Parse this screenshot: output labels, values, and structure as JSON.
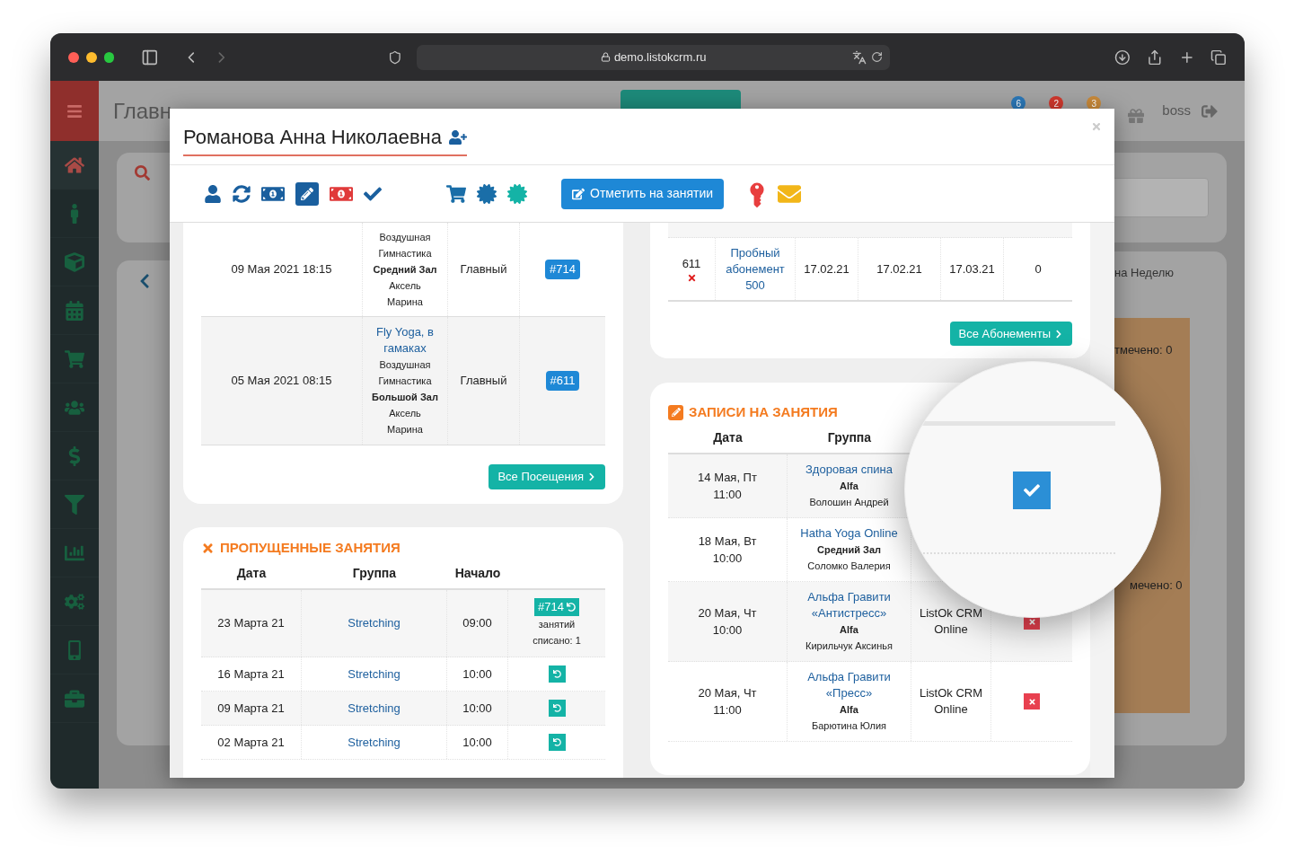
{
  "browser": {
    "url": "demo.listokcrm.ru"
  },
  "app": {
    "page_title": "Главн",
    "badges": [
      {
        "count": "6",
        "color": "#2b78b8"
      },
      {
        "count": "2",
        "color": "#d0392e"
      },
      {
        "count": "3",
        "color": "#c98a3a"
      }
    ],
    "user": "boss",
    "week_tab": "на Неделю",
    "calendar_notes": [
      "тмечено: 0",
      "мечено: 0"
    ]
  },
  "modal": {
    "title": "Романова Анна Николаевна",
    "mark_button": "Отметить на занятии",
    "visits": {
      "button": "Все Посещения",
      "rows": [
        {
          "date": "09 Мая 2021 18:15",
          "category": "Воздушная Гимнастика",
          "hall": "Средний Зал",
          "teacher": "Аксель Марина",
          "branch": "Главный",
          "badge": "#714"
        },
        {
          "date": "05 Мая 2021 08:15",
          "group": "Fly Yoga, в гамаках",
          "category": "Воздушная Гимнастика",
          "hall": "Большой Зал",
          "teacher": "Аксель Марина",
          "branch": "Главный",
          "badge": "#611"
        }
      ]
    },
    "missed": {
      "title": "ПРОПУЩЕННЫЕ ЗАНЯТИЯ",
      "columns": [
        "Дата",
        "Группа",
        "Начало"
      ],
      "rows": [
        {
          "date": "23 Марта 21",
          "group": "Stretching",
          "start": "09:00",
          "badge": "#714",
          "note": "занятий списано: 1"
        },
        {
          "date": "16 Марта 21",
          "group": "Stretching",
          "start": "10:00"
        },
        {
          "date": "09 Марта 21",
          "group": "Stretching",
          "start": "10:00"
        },
        {
          "date": "02 Марта 21",
          "group": "Stretching",
          "start": "10:00"
        }
      ]
    },
    "subscriptions": {
      "button": "Все Абонементы",
      "rows": [
        {
          "number": "611",
          "cancelled": true,
          "name": "Пробный абонемент 500",
          "cells": [
            "17.02.21",
            "17.02.21",
            "17.03.21",
            "0"
          ]
        }
      ]
    },
    "records": {
      "title": "ЗАПИСИ НА ЗАНЯТИЯ",
      "columns": [
        "Дата",
        "Группа"
      ],
      "rows": [
        {
          "date": "14 Мая, Пт",
          "time": "11:00",
          "group": "Здоровая спина",
          "hall": "Alfa",
          "teacher": "Волошин Андрей"
        },
        {
          "date": "18 Мая, Вт",
          "time": "10:00",
          "group": "Hatha Yoga Online",
          "hall": "Средний Зал",
          "teacher": "Соломко Валерия"
        },
        {
          "date": "20 Мая, Чт",
          "time": "10:00",
          "group": "Альфа Гравити «Антистресс»",
          "hall": "Alfa",
          "teacher": "Кирильчук Аксинья",
          "place": "ListOk CRM Online",
          "cancel": true
        },
        {
          "date": "20 Мая, Чт",
          "time": "11:00",
          "group": "Альфа Гравити «Пресс»",
          "hall": "Alfa",
          "teacher": "Барютина Юлия",
          "place": "ListOk CRM Online",
          "cancel": true
        }
      ]
    },
    "magnifier": {
      "checked": true
    }
  }
}
